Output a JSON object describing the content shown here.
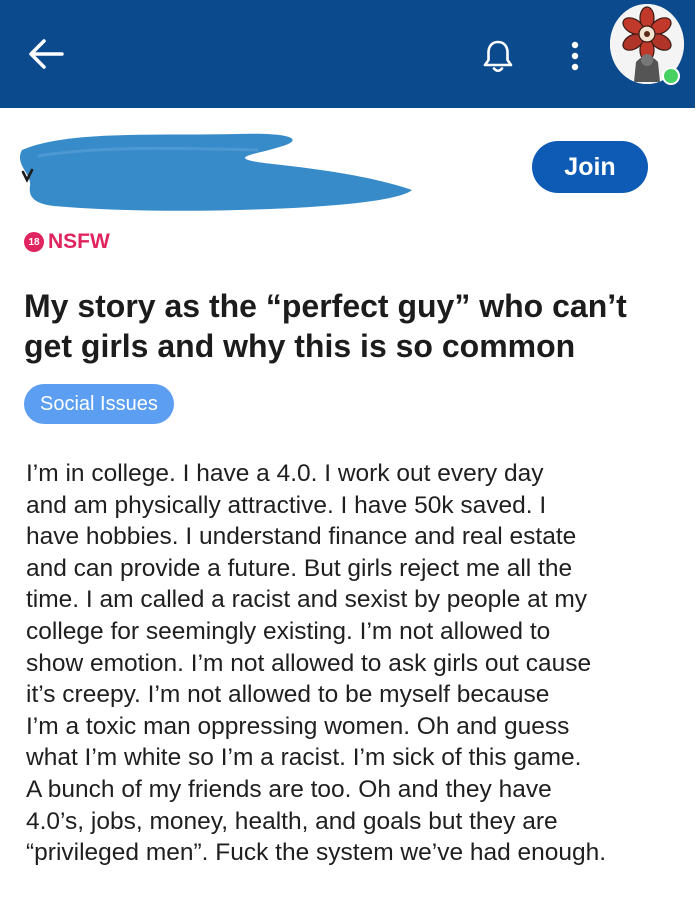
{
  "header": {
    "background_color": "#0b4a8c",
    "back_icon": "arrow-left-icon",
    "notification_icon": "bell-icon",
    "menu_icon": "kebab-menu-icon",
    "avatar_icon": "user-avatar",
    "online_status_color": "#46d160"
  },
  "community": {
    "name_redacted": true,
    "join_label": "Join",
    "join_color": "#0e5bb5"
  },
  "post": {
    "nsfw_badge": "18",
    "nsfw_label": "NSFW",
    "title_lines": [
      "My story as the “perfect guy” who can’t",
      "get girls and why this is so common"
    ],
    "flair": "Social Issues",
    "flair_color": "#5b9ef2",
    "body_lines": [
      "I’m in college. I have a 4.0. I work out every day",
      "and am physically attractive. I have 50k saved. I",
      "have hobbies. I understand finance and real estate",
      "and can provide a future. But girls reject me all the",
      "time. I am called a racist and sexist by people at my",
      "college for seemingly existing. I’m not allowed to",
      "show emotion. I’m not allowed to ask girls out cause",
      "it’s creepy. I’m not allowed to be myself because",
      "I’m a toxic man oppressing women. Oh and guess",
      "what I’m white so I’m a racist. I’m sick of this game.",
      "A bunch of my friends are too. Oh and they have",
      "4.0’s, jobs, money, health, and goals but they are",
      "“privileged men”. Fuck the system we’ve had enough."
    ]
  }
}
